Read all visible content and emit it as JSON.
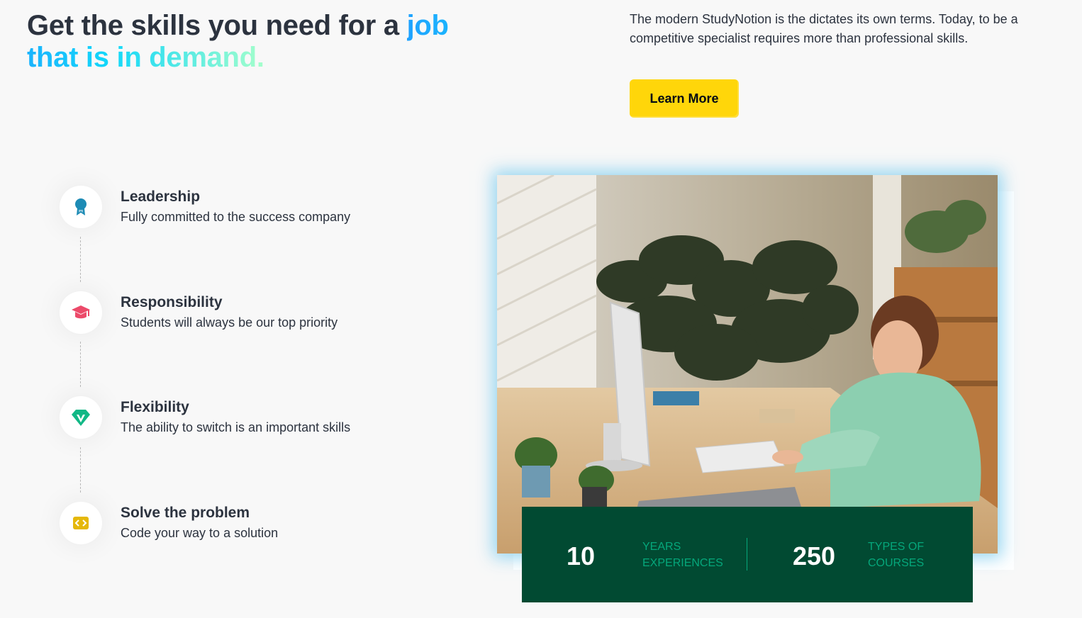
{
  "hero": {
    "headline_start": "Get the skills you need for a ",
    "headline_highlight": "job that is in demand.",
    "description": "The modern StudyNotion is the dictates its own terms. Today, to be a competitive specialist requires more than professional skills.",
    "button_label": "Learn More"
  },
  "features": [
    {
      "icon": "award-badge-icon",
      "title": "Leadership",
      "description": "Fully committed to the success company",
      "color": "#1d8bb5"
    },
    {
      "icon": "graduation-cap-icon",
      "title": "Responsibility",
      "description": "Students will always be our top priority",
      "color": "#ec4a6a"
    },
    {
      "icon": "diamond-icon",
      "title": "Flexibility",
      "description": "The ability to switch is an important skills",
      "color": "#12b886"
    },
    {
      "icon": "code-icon",
      "title": "Solve the problem",
      "description": "Code your way to a solution",
      "color": "#e5b80a"
    }
  ],
  "stats": {
    "years_value": "10",
    "years_label": "YEARS EXPERIENCES",
    "courses_value": "250",
    "courses_label": "TYPES OF COURSES"
  },
  "colors": {
    "accent_yellow": "#ffd60a",
    "stats_bg": "#014a32",
    "stats_label": "#05a77b",
    "gradient_start": "#1fa2ff",
    "gradient_end": "#a6ffcb"
  }
}
